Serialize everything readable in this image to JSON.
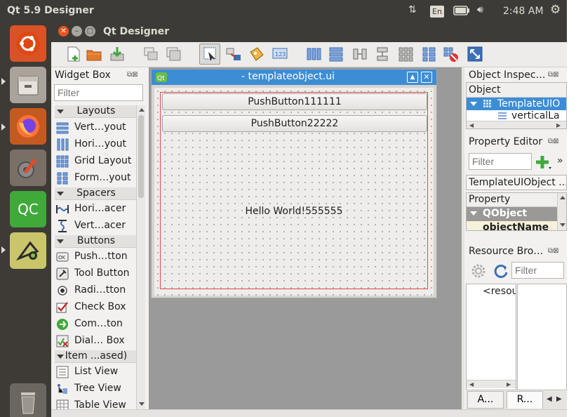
{
  "system_bar": {
    "title": "Qt 5.9 Designer",
    "input_method": "En",
    "time": "2:48 AM"
  },
  "window": {
    "title": "Qt Designer"
  },
  "widget_box": {
    "title": "Widget Box",
    "filter_placeholder": "Filter",
    "categories": [
      {
        "label": "Layouts"
      },
      {
        "label": "Spacers"
      },
      {
        "label": "Buttons"
      },
      {
        "label": "Item ...ased)"
      }
    ],
    "items": [
      {
        "label": "Vert…yout"
      },
      {
        "label": "Hori…yout"
      },
      {
        "label": "Grid Layout"
      },
      {
        "label": "Form…yout"
      },
      {
        "label": "Hori…acer"
      },
      {
        "label": "Vert…acer"
      },
      {
        "label": "Push…tton"
      },
      {
        "label": "Tool Button"
      },
      {
        "label": "Radi…tton"
      },
      {
        "label": "Check Box"
      },
      {
        "label": "Com…ton"
      },
      {
        "label": "Dial… Box"
      },
      {
        "label": "List View"
      },
      {
        "label": "Tree View"
      },
      {
        "label": "Table View"
      }
    ]
  },
  "form": {
    "title": "- templateobject.ui",
    "button1": "PushButton111111",
    "button2": "PushButton22222",
    "label": "Hello World!555555"
  },
  "object_inspector": {
    "title": "Object Inspec…",
    "column": "Object",
    "row1": "TemplateUIO",
    "row2": "verticalLa"
  },
  "property_editor": {
    "title": "Property Editor",
    "filter_placeholder": "Filter",
    "object_name": "TemplateUIObject ...",
    "column": "Property",
    "group": "QObject",
    "row": "objectName"
  },
  "resource_browser": {
    "title": "Resource Bro…",
    "filter_placeholder": "Filter",
    "tree_item": "<resou",
    "tab1": "A...",
    "tab2": "R..."
  }
}
